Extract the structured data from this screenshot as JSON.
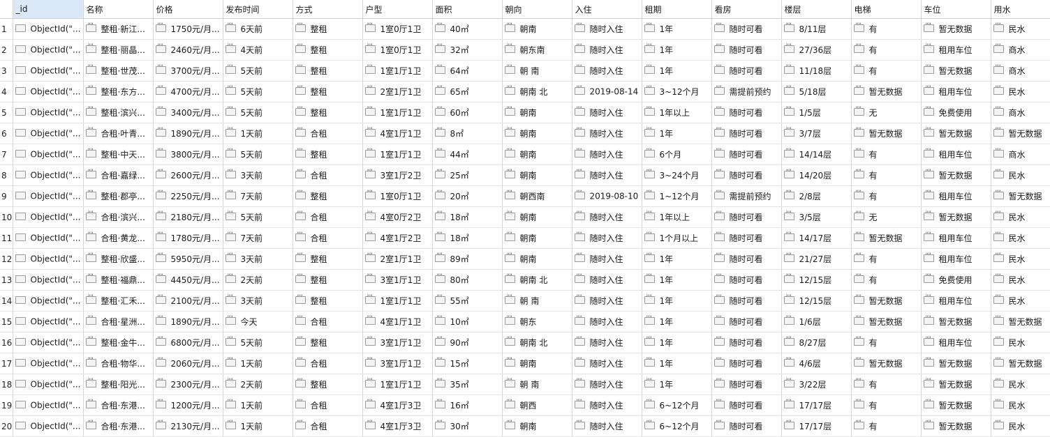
{
  "columns": [
    "_id",
    "名称",
    "价格",
    "发布时间",
    "方式",
    "户型",
    "面积",
    "朝向",
    "入住",
    "租期",
    "看房",
    "楼层",
    "电梯",
    "车位",
    "用水"
  ],
  "rows": [
    {
      "n": "1",
      "c": [
        "ObjectId(\"...",
        "整租·新江...",
        "1750元/月...",
        "6天前",
        "整租",
        "1室0厅1卫",
        "40㎡",
        "朝南",
        "随时入住",
        "1年",
        "随时可看",
        "8/11层",
        "有",
        "暂无数据",
        "民水"
      ]
    },
    {
      "n": "2",
      "c": [
        "ObjectId(\"...",
        "整租·丽晶...",
        "2460元/月...",
        "4天前",
        "整租",
        "1室0厅1卫",
        "32㎡",
        "朝东南",
        "随时入住",
        "1年",
        "随时可看",
        "27/36层",
        "有",
        "租用车位",
        "商水"
      ]
    },
    {
      "n": "3",
      "c": [
        "ObjectId(\"...",
        "整租·世茂...",
        "3700元/月...",
        "5天前",
        "整租",
        "1室1厅1卫",
        "64㎡",
        "朝 南",
        "随时入住",
        "1年",
        "随时可看",
        "11/18层",
        "有",
        "暂无数据",
        "商水"
      ]
    },
    {
      "n": "4",
      "c": [
        "ObjectId(\"...",
        "整租·东方...",
        "4700元/月...",
        "5天前",
        "整租",
        "2室1厅1卫",
        "65㎡",
        "朝南 北",
        "2019-08-14",
        "3~12个月",
        "需提前预约",
        "5/18层",
        "暂无数据",
        "租用车位",
        "民水"
      ]
    },
    {
      "n": "5",
      "c": [
        "ObjectId(\"...",
        "整租·滨兴...",
        "3400元/月...",
        "5天前",
        "整租",
        "1室1厅1卫",
        "60㎡",
        "朝南",
        "随时入住",
        "1年以上",
        "随时可看",
        "1/5层",
        "无",
        "免费使用",
        "商水"
      ]
    },
    {
      "n": "6",
      "c": [
        "ObjectId(\"...",
        "合租·叶青...",
        "1890元/月...",
        "1天前",
        "合租",
        "4室1厅1卫",
        "8㎡",
        "朝南",
        "随时入住",
        "1年",
        "随时可看",
        "3/7层",
        "暂无数据",
        "暂无数据",
        "暂无数据"
      ]
    },
    {
      "n": "7",
      "c": [
        "ObjectId(\"...",
        "整租·中天...",
        "3800元/月...",
        "5天前",
        "整租",
        "1室1厅1卫",
        "44㎡",
        "朝南",
        "随时入住",
        "6个月",
        "随时可看",
        "14/14层",
        "有",
        "租用车位",
        "商水"
      ]
    },
    {
      "n": "8",
      "c": [
        "ObjectId(\"...",
        "合租·嘉绿...",
        "2600元/月...",
        "3天前",
        "合租",
        "3室1厅2卫",
        "25㎡",
        "朝南",
        "随时入住",
        "3~24个月",
        "随时可看",
        "14/20层",
        "有",
        "暂无数据",
        "民水"
      ]
    },
    {
      "n": "9",
      "c": [
        "ObjectId(\"...",
        "整租·郡亭...",
        "2250元/月...",
        "7天前",
        "整租",
        "1室0厅1卫",
        "20㎡",
        "朝西南",
        "2019-08-10",
        "1~12个月",
        "需提前预约",
        "2/8层",
        "有",
        "租用车位",
        "暂无数据"
      ]
    },
    {
      "n": "10",
      "c": [
        "ObjectId(\"...",
        "合租·滨兴...",
        "2180元/月...",
        "5天前",
        "合租",
        "4室0厅2卫",
        "18㎡",
        "朝南",
        "随时入住",
        "1年以上",
        "随时可看",
        "3/5层",
        "无",
        "暂无数据",
        "民水"
      ]
    },
    {
      "n": "11",
      "c": [
        "ObjectId(\"...",
        "合租·黄龙...",
        "1780元/月...",
        "7天前",
        "合租",
        "4室1厅2卫",
        "18㎡",
        "朝南",
        "随时入住",
        "1个月以上",
        "随时可看",
        "14/17层",
        "暂无数据",
        "租用车位",
        "民水"
      ]
    },
    {
      "n": "12",
      "c": [
        "ObjectId(\"...",
        "整租·欣盛...",
        "5950元/月...",
        "3天前",
        "整租",
        "2室1厅1卫",
        "89㎡",
        "朝南",
        "随时入住",
        "1年",
        "随时可看",
        "21/27层",
        "有",
        "租用车位",
        "民水"
      ]
    },
    {
      "n": "13",
      "c": [
        "ObjectId(\"...",
        "整租·福鼎...",
        "4450元/月...",
        "2天前",
        "整租",
        "3室1厅1卫",
        "80㎡",
        "朝南 北",
        "随时入住",
        "1年",
        "随时可看",
        "12/15层",
        "有",
        "免费使用",
        "民水"
      ]
    },
    {
      "n": "14",
      "c": [
        "ObjectId(\"...",
        "整租·汇禾...",
        "2100元/月...",
        "3天前",
        "整租",
        "1室1厅1卫",
        "55㎡",
        "朝 南",
        "随时入住",
        "1年",
        "随时可看",
        "12/15层",
        "暂无数据",
        "租用车位",
        "民水"
      ]
    },
    {
      "n": "15",
      "c": [
        "ObjectId(\"...",
        "合租·星洲...",
        "1890元/月...",
        "今天",
        "合租",
        "4室1厅1卫",
        "10㎡",
        "朝东",
        "随时入住",
        "1年",
        "随时可看",
        "1/6层",
        "暂无数据",
        "暂无数据",
        "暂无数据"
      ]
    },
    {
      "n": "16",
      "c": [
        "ObjectId(\"...",
        "整租·金牛...",
        "6800元/月...",
        "5天前",
        "整租",
        "3室1厅1卫",
        "90㎡",
        "朝南 北",
        "随时入住",
        "1年",
        "随时可看",
        "8/27层",
        "有",
        "租用车位",
        "民水"
      ]
    },
    {
      "n": "17",
      "c": [
        "ObjectId(\"...",
        "合租·物华...",
        "2060元/月...",
        "1天前",
        "合租",
        "3室1厅1卫",
        "15㎡",
        "朝南",
        "随时入住",
        "1年",
        "随时可看",
        "4/6层",
        "暂无数据",
        "暂无数据",
        "暂无数据"
      ]
    },
    {
      "n": "18",
      "c": [
        "ObjectId(\"...",
        "整租·阳光...",
        "2300元/月...",
        "2天前",
        "整租",
        "1室1厅1卫",
        "35㎡",
        "朝 南",
        "随时入住",
        "1年",
        "随时可看",
        "3/22层",
        "有",
        "暂无数据",
        "民水"
      ]
    },
    {
      "n": "19",
      "c": [
        "ObjectId(\"...",
        "合租·东港...",
        "1200元/月...",
        "1天前",
        "合租",
        "4室1厅3卫",
        "16㎡",
        "朝西",
        "随时入住",
        "6~12个月",
        "随时可看",
        "17/17层",
        "有",
        "暂无数据",
        "民水"
      ]
    },
    {
      "n": "20",
      "c": [
        "ObjectId(\"...",
        "合租·东港...",
        "2130元/月...",
        "1天前",
        "合租",
        "4室1厅3卫",
        "30㎡",
        "朝南",
        "随时入住",
        "6~12个月",
        "随时可看",
        "17/17层",
        "有",
        "暂无数据",
        "民水"
      ]
    }
  ]
}
